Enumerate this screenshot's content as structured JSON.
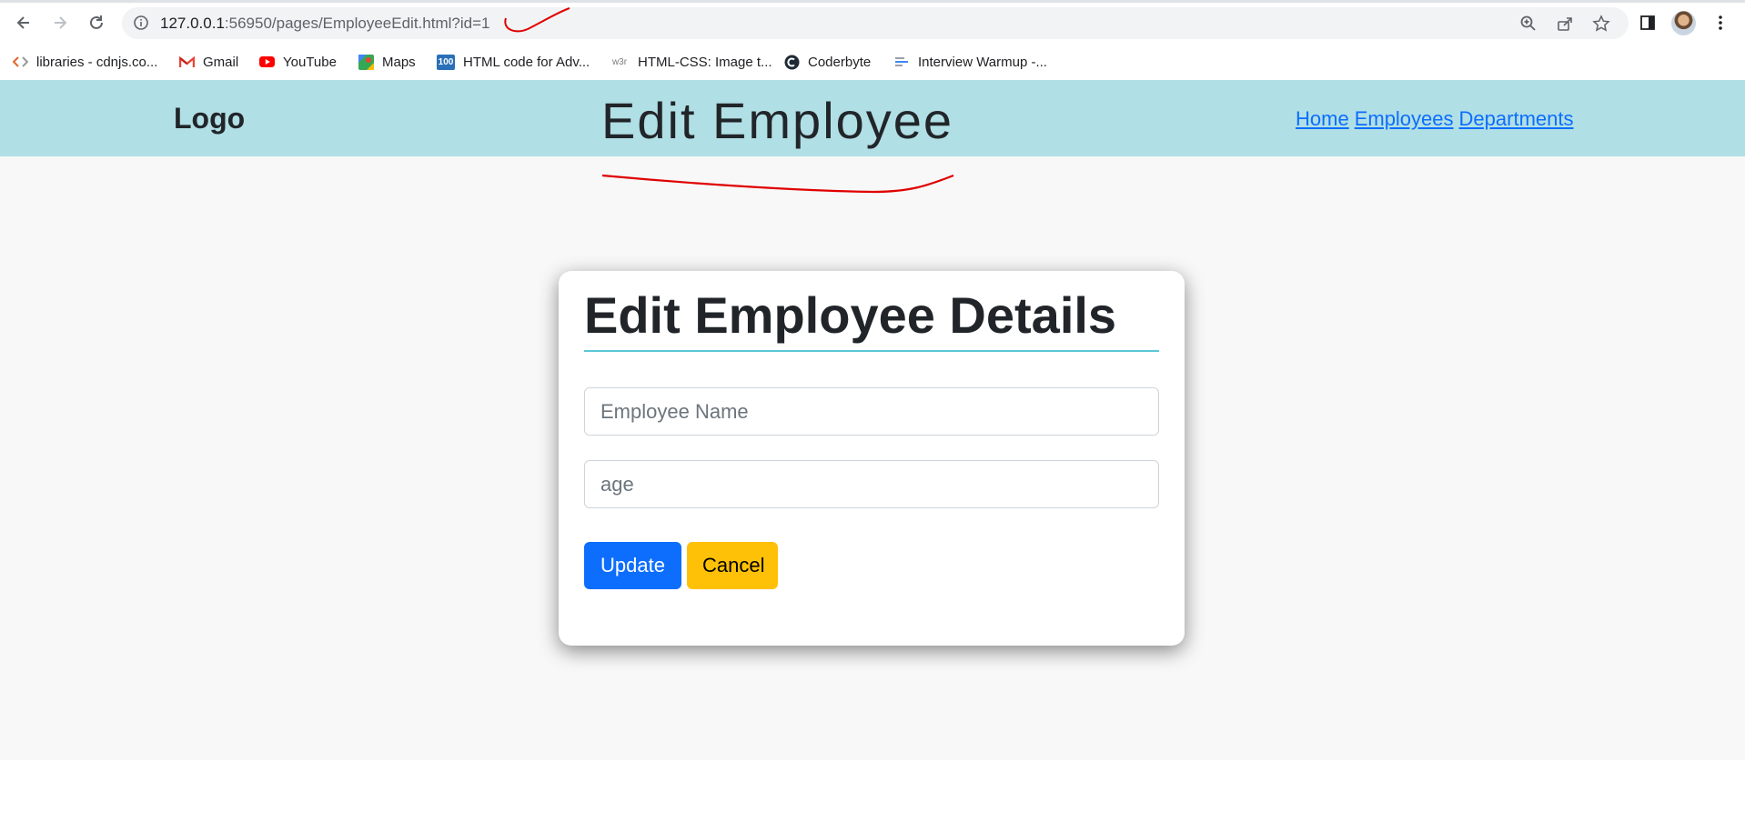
{
  "browser": {
    "url_host": "127.0.0.1",
    "url_rest": ":56950/pages/EmployeeEdit.html?id=1",
    "bookmarks": [
      {
        "label": "libraries - cdnjs.co...",
        "icon": "code-icon"
      },
      {
        "label": "Gmail",
        "icon": "gmail-icon"
      },
      {
        "label": "YouTube",
        "icon": "youtube-icon"
      },
      {
        "label": "Maps",
        "icon": "maps-icon"
      },
      {
        "label": "HTML code for Adv...",
        "icon": "100-icon",
        "icon_text": "100"
      },
      {
        "label": "HTML-CSS: Image t...",
        "icon": "w3r-icon",
        "icon_text": "w3r"
      },
      {
        "label": "Coderbyte",
        "icon": "coderbyte-icon"
      },
      {
        "label": "Interview Warmup -...",
        "icon": "interview-icon"
      }
    ]
  },
  "header": {
    "logo": "Logo",
    "title": "Edit Employee",
    "nav": [
      "Home",
      "Employees",
      "Departments"
    ]
  },
  "card": {
    "title": "Edit Employee Details",
    "name_placeholder": "Employee Name",
    "age_placeholder": "age",
    "update_label": "Update",
    "cancel_label": "Cancel"
  },
  "colors": {
    "header_bg": "#b0dfe5",
    "primary": "#0d6efd",
    "warning": "#ffc107",
    "rule": "#5bc7d6",
    "annotation": "#e00000"
  }
}
